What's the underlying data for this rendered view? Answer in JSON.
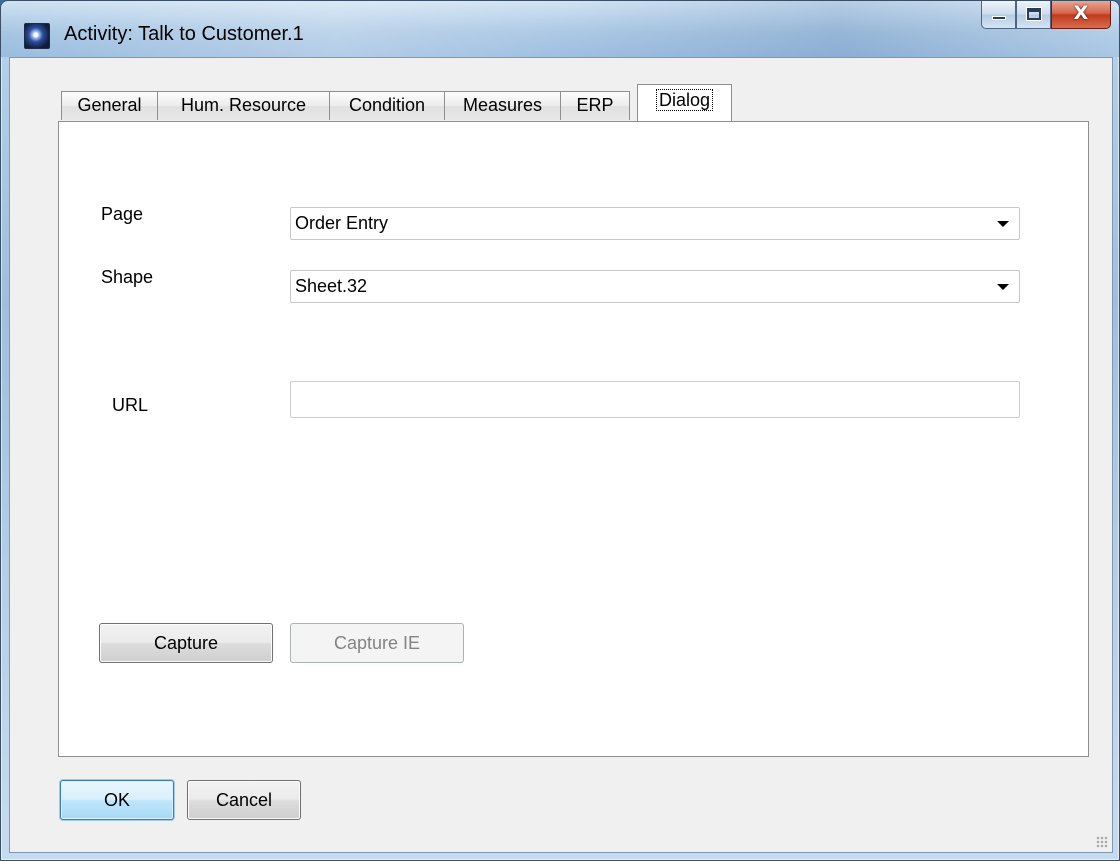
{
  "window": {
    "title": "Activity: Talk to Customer.1",
    "controls": {
      "minimize": "minimize-icon",
      "maximize": "maximize-icon",
      "close_glyph": "X"
    }
  },
  "tabs": [
    {
      "label": "General",
      "active": false
    },
    {
      "label": "Hum. Resource",
      "active": false
    },
    {
      "label": "Condition",
      "active": false
    },
    {
      "label": "Measures",
      "active": false
    },
    {
      "label": "ERP",
      "active": false
    },
    {
      "label": "Dialog",
      "active": true
    }
  ],
  "dialog_tab": {
    "page_label": "Page",
    "page_value": "Order Entry",
    "shape_label": "Shape",
    "shape_value": "Sheet.32",
    "url_label": "URL",
    "url_value": "",
    "capture_button": "Capture",
    "capture_ie_button": "Capture IE"
  },
  "footer": {
    "ok_button": "OK",
    "cancel_button": "Cancel"
  },
  "colors": {
    "accent_default_button": "#3c7fb1",
    "close_button": "#c23a1c",
    "disabled_text": "#838383"
  }
}
